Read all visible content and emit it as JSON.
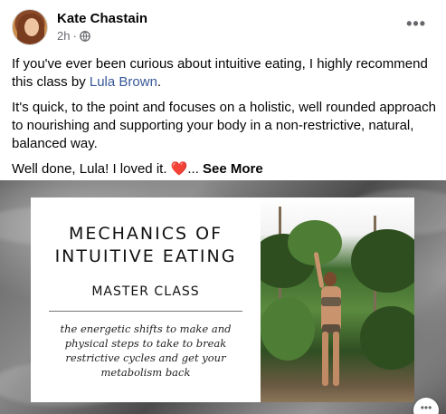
{
  "post": {
    "author": "Kate Chastain",
    "time": "2h",
    "separator": "·",
    "more_label": "•••",
    "icons": {
      "privacy": "globe-icon",
      "more": "more-horizontal-icon",
      "heart": "red-heart-icon"
    },
    "body": {
      "p1_text": "If you've ever been curious about intuitive eating, I highly recommend this class by ",
      "p1_link": "Lula Brown",
      "p1_end": ".",
      "p2": "It's quick, to the point and focuses on a holistic, well rounded approach to nourishing and supporting your body in a non-restrictive, natural, balanced way.",
      "p3_text": "Well done, Lula! I loved it. ",
      "p3_heart": "❤️",
      "p3_ellipsis": "...",
      "see_more": "See More"
    }
  },
  "media": {
    "title_line1": "MECHANICS OF",
    "title_line2": "INTUITIVE EATING",
    "subtitle": "MASTER CLASS",
    "description": "the energetic shifts to make and physical steps to take to break restrictive cycles and get your metabolism back",
    "corner_glyph": "•••"
  },
  "colors": {
    "link": "#385898",
    "meta": "#65676b",
    "text": "#050505"
  }
}
